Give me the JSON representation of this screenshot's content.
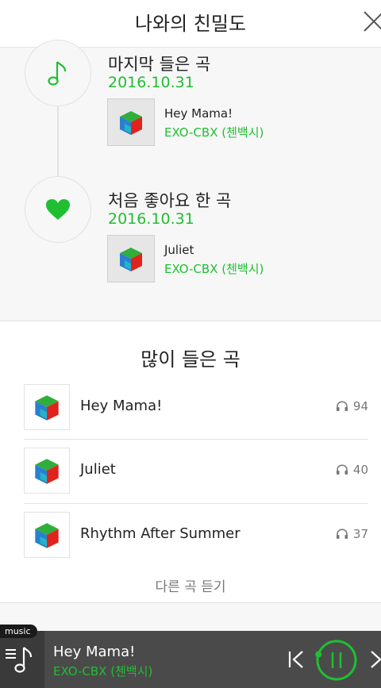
{
  "header": {
    "title": "나와의 친밀도"
  },
  "timeline": {
    "items": [
      {
        "label": "마지막 들은 곡",
        "date": "2016.10.31",
        "song": "Hey Mama!",
        "artist": "EXO-CBX (첸백시)",
        "icon": "music-note-icon"
      },
      {
        "label": "처음 좋아요 한 곡",
        "date": "2016.10.31",
        "song": "Juliet",
        "artist": "EXO-CBX (첸백시)",
        "icon": "heart-icon"
      }
    ]
  },
  "most_played": {
    "title": "많이 들은 곡",
    "rows": [
      {
        "title": "Hey Mama!",
        "plays": "94"
      },
      {
        "title": "Juliet",
        "plays": "40"
      },
      {
        "title": "Rhythm After Summer",
        "plays": "37"
      }
    ],
    "more_label": "다른 곡 듣기"
  },
  "player": {
    "badge": "music",
    "song": "Hey Mama!",
    "artist": "EXO-CBX (첸백시)",
    "progress": 0.05
  },
  "colors": {
    "accent_green": "#1fbf31",
    "player_bg": "#4a4a4a"
  }
}
